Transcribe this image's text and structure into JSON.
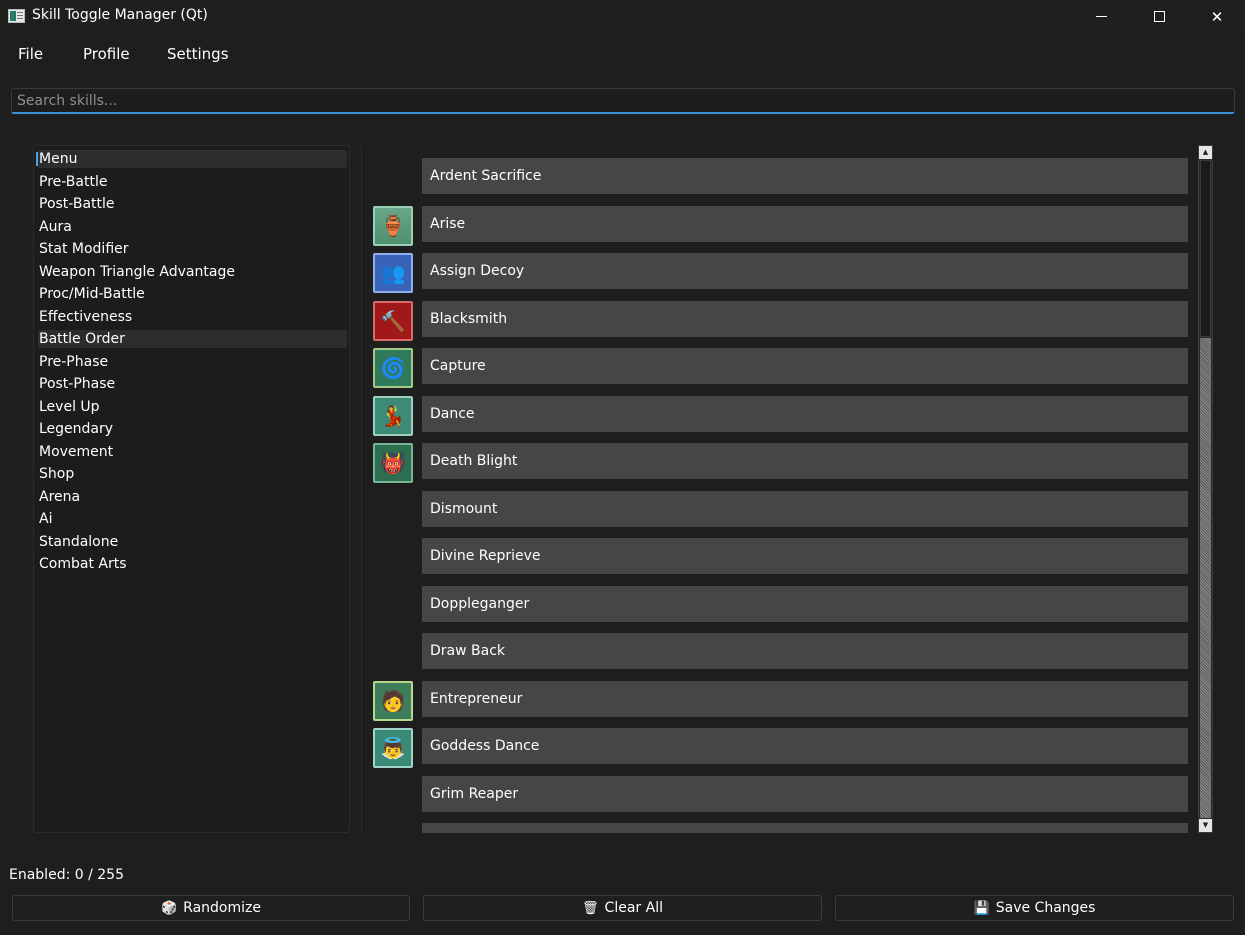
{
  "window": {
    "title": "Skill Toggle Manager (Qt)"
  },
  "menu": [
    "File",
    "Profile",
    "Settings"
  ],
  "search": {
    "placeholder": "Search skills...",
    "value": ""
  },
  "categories": [
    "Menu",
    "Pre-Battle",
    "Post-Battle",
    "Aura",
    "Stat Modifier",
    "Weapon Triangle Advantage",
    "Proc/Mid-Battle",
    "Effectiveness",
    "Battle Order",
    "Pre-Phase",
    "Post-Phase",
    "Level Up",
    "Legendary",
    "Movement",
    "Shop",
    "Arena",
    "Ai",
    "Standalone",
    "Combat Arts"
  ],
  "category_selected": "Menu",
  "category_hover": "Battle Order",
  "skills": [
    {
      "name": "Ardent Sacrifice",
      "icon": ""
    },
    {
      "name": "Arise",
      "icon": "arise-icon"
    },
    {
      "name": "Assign Decoy",
      "icon": "assign-decoy-icon"
    },
    {
      "name": "Blacksmith",
      "icon": "blacksmith-icon"
    },
    {
      "name": "Capture",
      "icon": "capture-icon"
    },
    {
      "name": "Dance",
      "icon": "dance-icon"
    },
    {
      "name": "Death Blight",
      "icon": "death-blight-icon"
    },
    {
      "name": "Dismount",
      "icon": ""
    },
    {
      "name": "Divine Reprieve",
      "icon": ""
    },
    {
      "name": "Doppleganger",
      "icon": ""
    },
    {
      "name": "Draw Back",
      "icon": ""
    },
    {
      "name": "Entrepreneur",
      "icon": "entrepreneur-icon"
    },
    {
      "name": "Goddess Dance",
      "icon": "goddess-dance-icon"
    },
    {
      "name": "Grim Reaper",
      "icon": ""
    }
  ],
  "status": {
    "label": "Enabled: 0 / 255"
  },
  "actions": {
    "randomize": "Randomize",
    "clear_all": "Clear All",
    "save": "Save Changes"
  },
  "colors": {
    "accent": "#3a8fd6",
    "skill_button": "#464646",
    "background": "#1e1e1e"
  }
}
